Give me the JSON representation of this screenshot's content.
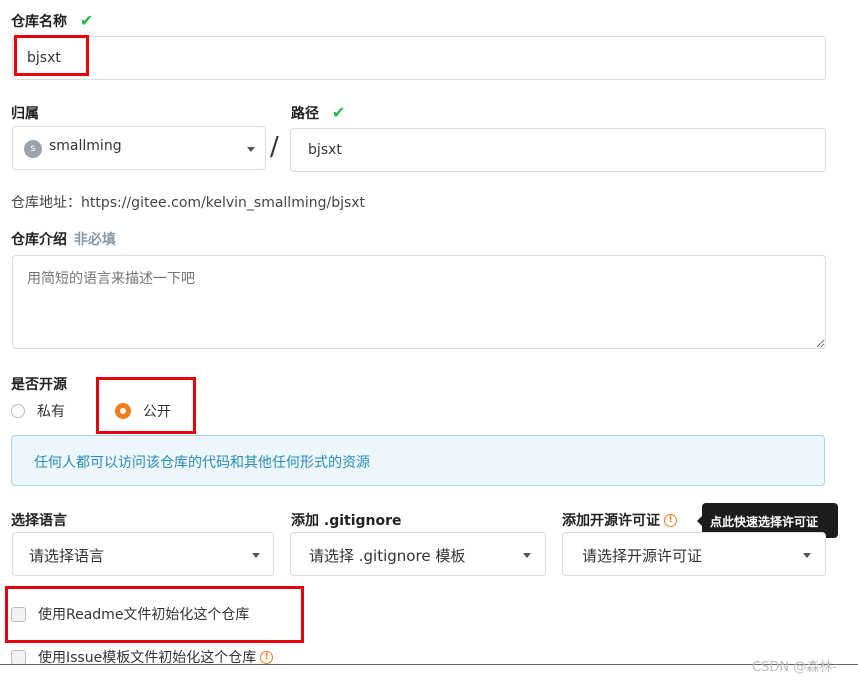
{
  "repo_name": {
    "label": "仓库名称",
    "value": "bjsxt"
  },
  "owner": {
    "label": "归属",
    "avatar_letter": "s",
    "value": "smallming"
  },
  "separator": "/",
  "path": {
    "label": "路径",
    "value": "bjsxt"
  },
  "repo_url": "仓库地址：https://gitee.com/kelvin_smallming/bjsxt",
  "description": {
    "label": "仓库介绍",
    "optional": "非必填",
    "placeholder": "用简短的语言来描述一下吧"
  },
  "visibility": {
    "label": "是否开源",
    "private_label": "私有",
    "public_label": "公开",
    "selected": "public"
  },
  "notice": "任何人都可以访问该仓库的代码和其他任何形式的资源",
  "language": {
    "label": "选择语言",
    "placeholder": "请选择语言"
  },
  "gitignore": {
    "label": "添加 .gitignore",
    "placeholder": "请选择 .gitignore 模板"
  },
  "license": {
    "label": "添加开源许可证",
    "placeholder": "请选择开源许可证",
    "tooltip": "点此快速选择许可证"
  },
  "init_readme": {
    "label": "使用Readme文件初始化这个仓库",
    "checked": false
  },
  "init_issue": {
    "label": "使用Issue模板文件初始化这个仓库",
    "checked": false
  },
  "watermark": "CSDN @森林-",
  "colors": {
    "accent": "#f57b20",
    "success": "#21ba45",
    "highlight": "#e8000b",
    "notice_bg": "#edf7fb",
    "notice_border": "#a9d5e4",
    "notice_text": "#2a8ab8"
  }
}
